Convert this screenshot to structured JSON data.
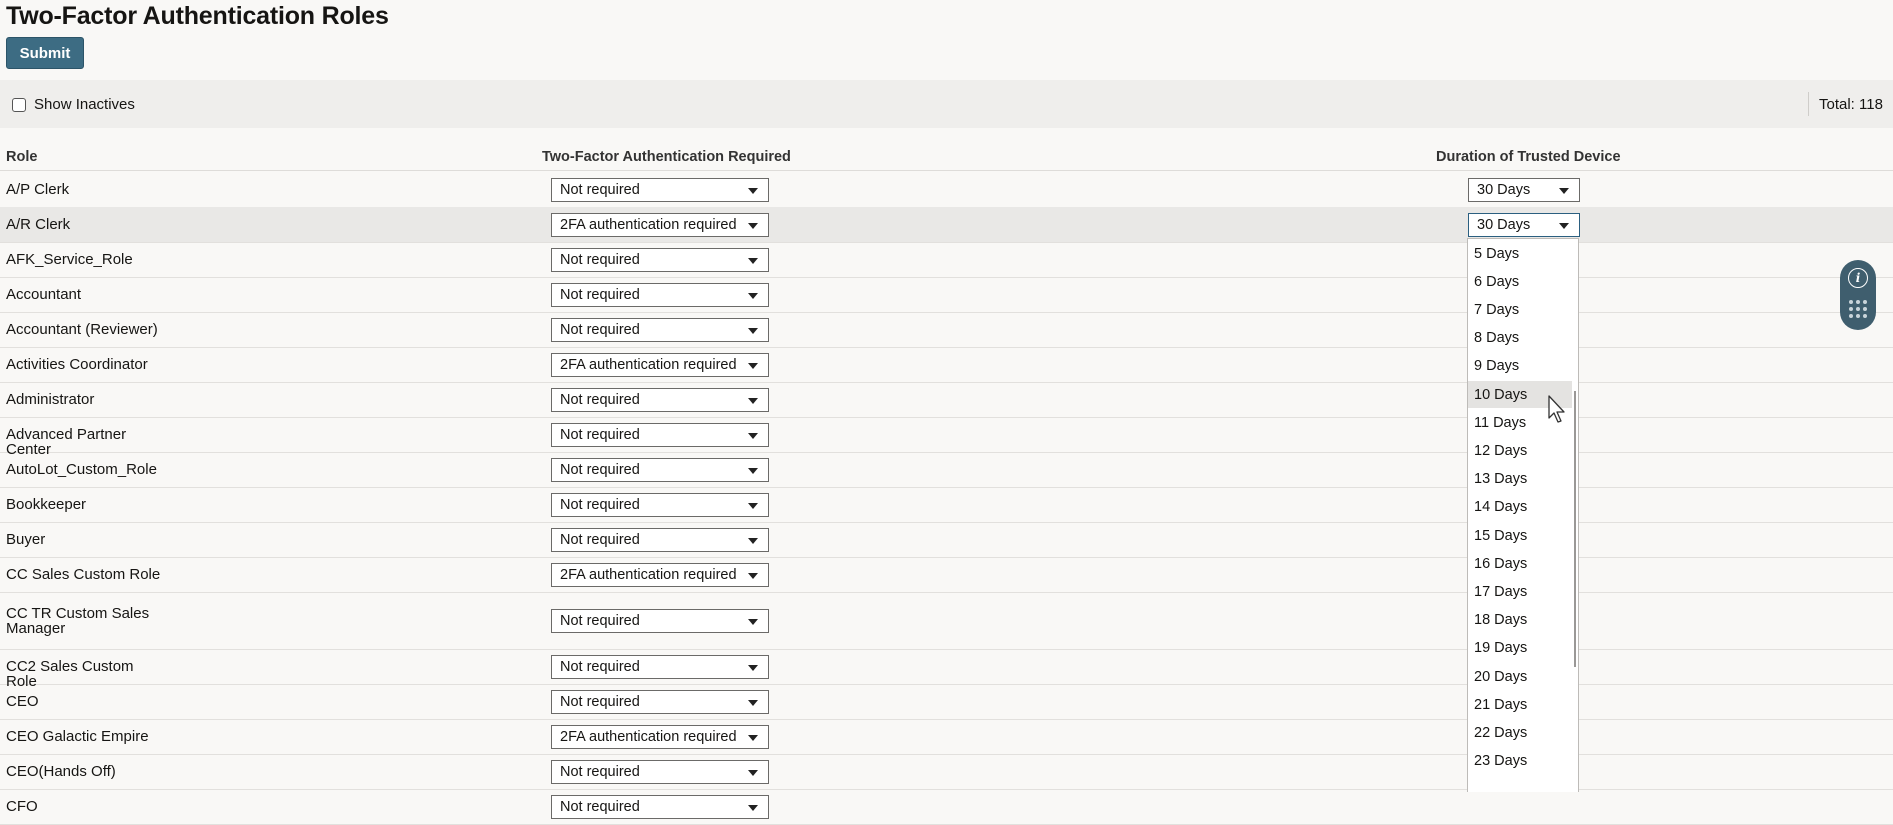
{
  "page": {
    "title": "Two-Factor Authentication Roles",
    "submit_label": "Submit"
  },
  "filter": {
    "show_inactives_label": "Show Inactives",
    "total_label": "Total: 118"
  },
  "table": {
    "headers": {
      "role": "Role",
      "two_factor": "Two-Factor Authentication Required",
      "duration": "Duration of Trusted Device"
    },
    "rows": [
      {
        "role": "A/P Clerk",
        "tfa": "Not required",
        "duration": "30 Days"
      },
      {
        "role": "A/R Clerk",
        "tfa": "2FA authentication required",
        "duration": "30 Days"
      },
      {
        "role": "AFK_Service_Role",
        "tfa": "Not required"
      },
      {
        "role": "Accountant",
        "tfa": "Not required"
      },
      {
        "role": "Accountant (Reviewer)",
        "tfa": "Not required"
      },
      {
        "role": "Activities Coordinator",
        "tfa": "2FA authentication required"
      },
      {
        "role": "Administrator",
        "tfa": "Not required"
      },
      {
        "role": "Advanced Partner Center",
        "tfa": "Not required"
      },
      {
        "role": "AutoLot_Custom_Role",
        "tfa": "Not required"
      },
      {
        "role": "Bookkeeper",
        "tfa": "Not required"
      },
      {
        "role": "Buyer",
        "tfa": "Not required"
      },
      {
        "role": "CC Sales Custom Role",
        "tfa": "2FA authentication required"
      },
      {
        "role": "CC TR Custom Sales Manager",
        "tfa": "Not required"
      },
      {
        "role": "CC2 Sales Custom Role",
        "tfa": "Not required"
      },
      {
        "role": "CEO",
        "tfa": "Not required"
      },
      {
        "role": "CEO Galactic Empire",
        "tfa": "2FA authentication required"
      },
      {
        "role": "CEO(Hands Off)",
        "tfa": "Not required"
      },
      {
        "role": "CFO",
        "tfa": "Not required"
      }
    ]
  },
  "duration_dropdown": {
    "hovered": "10 Days",
    "options": [
      "5 Days",
      "6 Days",
      "7 Days",
      "8 Days",
      "9 Days",
      "10 Days",
      "11 Days",
      "12 Days",
      "13 Days",
      "14 Days",
      "15 Days",
      "16 Days",
      "17 Days",
      "18 Days",
      "19 Days",
      "20 Days",
      "21 Days",
      "22 Days",
      "23 Days"
    ]
  },
  "widget": {
    "info_icon": "info-icon",
    "grid_icon": "grid-dots-icon",
    "info_glyph": "i"
  },
  "colors": {
    "accent": "#3d6c83",
    "widget": "#3f5e6e"
  }
}
